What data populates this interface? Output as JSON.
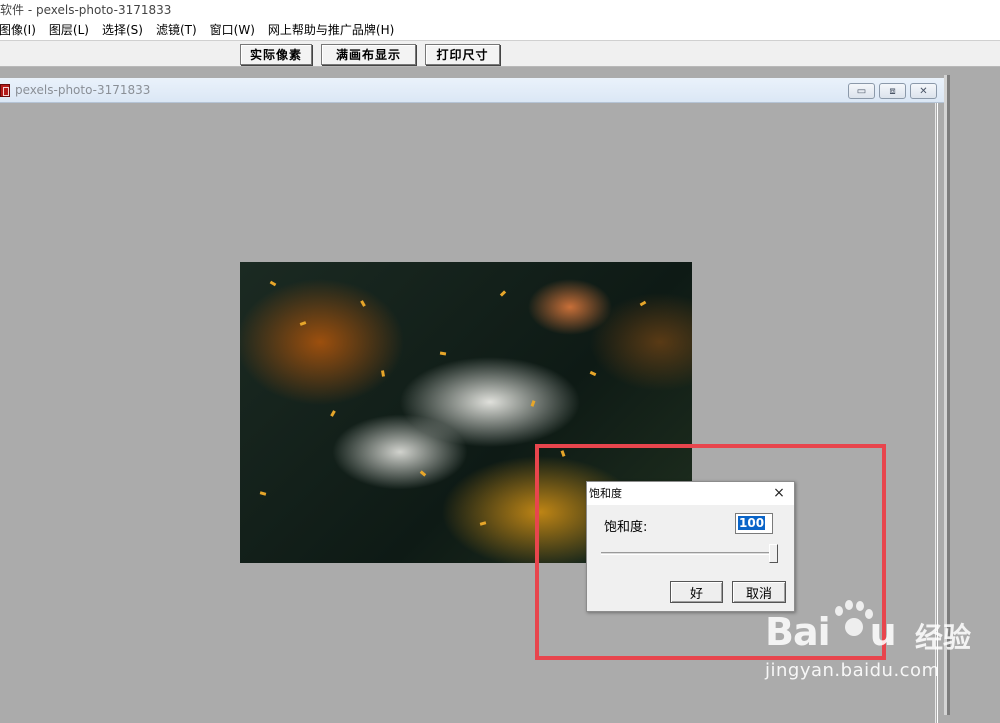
{
  "app": {
    "title": "软件 - pexels-photo-3171833"
  },
  "menu": [
    "图像(I)",
    "图层(L)",
    "选择(S)",
    "滤镜(T)",
    "窗口(W)",
    "网上帮助与推广品牌(H)"
  ],
  "toolbar": {
    "actual_pixels": "实际像素",
    "fit_canvas": "满画布显示",
    "print_size": "打印尺寸"
  },
  "document": {
    "title": "pexels-photo-3171833",
    "icon": "image-document-icon",
    "controls": {
      "minimize_icon": "minimize-icon",
      "restore_icon": "restore-icon",
      "close_icon": "close-icon"
    }
  },
  "dialog": {
    "title": "饱和度",
    "label": "饱和度:",
    "value": "100",
    "slider": {
      "min": 0,
      "max": 100,
      "value": 100
    },
    "ok": "好",
    "cancel": "取消",
    "close_icon": "×"
  },
  "highlight_color": "#e8454d",
  "watermark": {
    "brand": "Bai",
    "brand_suffix": "u",
    "cn": "经验",
    "url": "jingyan.baidu.com"
  }
}
